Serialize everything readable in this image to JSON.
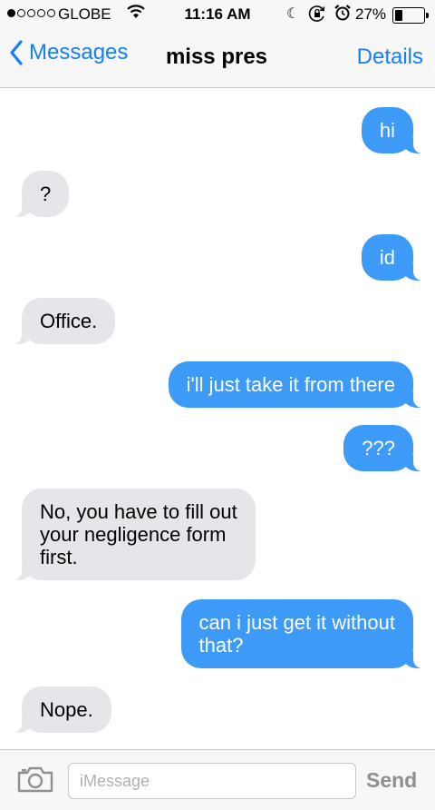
{
  "status_bar": {
    "signal_dots": [
      true,
      false,
      false,
      false,
      false
    ],
    "carrier": "GLOBE",
    "time": "11:16 AM",
    "battery": "27%",
    "battery_level": 0.27
  },
  "nav": {
    "back_label": "Messages",
    "title": "miss pres",
    "details_label": "Details"
  },
  "messages": [
    {
      "sender": "me",
      "text": "hi"
    },
    {
      "sender": "them",
      "text": "?"
    },
    {
      "sender": "me",
      "text": "id"
    },
    {
      "sender": "them",
      "text": "Office."
    },
    {
      "sender": "me",
      "text": "i'll just take it from there"
    },
    {
      "sender": "me",
      "text": "???"
    },
    {
      "sender": "them",
      "text": "No, you have to fill out your negligence form first.",
      "lines": [
        "No, you have to fill out",
        "your negligence form",
        "first."
      ]
    },
    {
      "sender": "me",
      "text": "can i just get it without that?",
      "lines": [
        "can i just get it without",
        "that?"
      ]
    },
    {
      "sender": "them",
      "text": "Nope."
    }
  ],
  "input_bar": {
    "placeholder": "iMessage",
    "send_label": "Send"
  },
  "colors": {
    "accent": "#157efb",
    "outgoing_bubble": "#3d9bf7",
    "incoming_bubble": "#e5e5ea"
  }
}
